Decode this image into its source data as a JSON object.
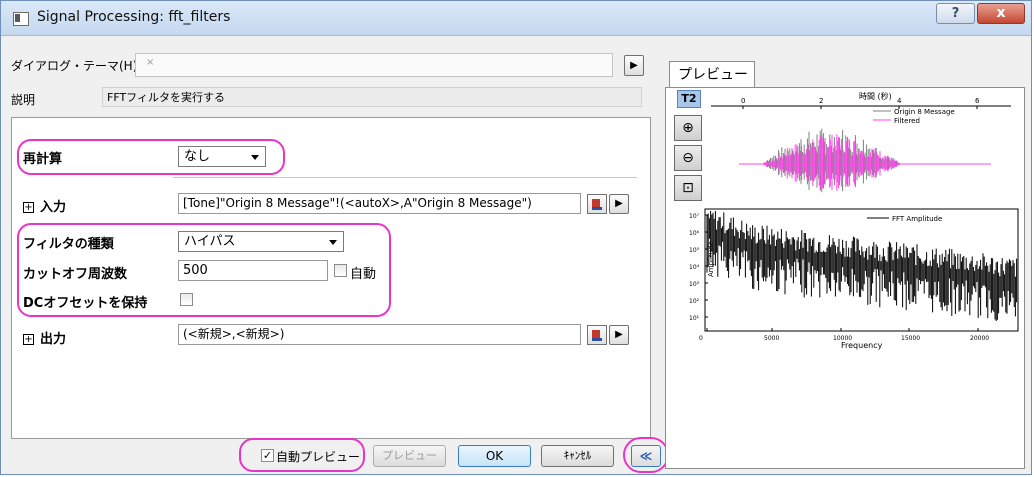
{
  "window": {
    "title": "Signal Processing: fft_filters"
  },
  "titlebar": {
    "help_label": "?",
    "close_label": "x"
  },
  "theme": {
    "label": "ダイアログ・テーマ(H)",
    "value": "",
    "clear_glyph": "×",
    "menu_arrow": "▶"
  },
  "description": {
    "label": "説明",
    "value": "FFTフィルタを実行する"
  },
  "recalc": {
    "label": "再計算",
    "value": "なし"
  },
  "input": {
    "label": "入力",
    "expander": "⊞",
    "value": "[Tone]\"Origin 8 Message\"!(<autoX>,A\"Origin 8 Message\")"
  },
  "filter_type": {
    "label": "フィルタの種類",
    "value": "ハイパス"
  },
  "cutoff": {
    "label": "カットオフ周波数",
    "value": "500",
    "auto_label": "自動",
    "auto_checked": false
  },
  "dc_offset": {
    "label": "DCオフセットを保持",
    "checked": false
  },
  "output": {
    "label": "出力",
    "expander": "⊞",
    "value": "(<新規>,<新規>)"
  },
  "buttons": {
    "auto_preview_label": "自動プレビュー",
    "auto_preview_checked": true,
    "preview_label": "プレビュー",
    "ok_label": "OK",
    "cancel_label": "ｷｬﾝｾﾙ",
    "collapse_label": "≪"
  },
  "preview": {
    "tab_label": "プレビュー",
    "t2_label": "T2",
    "tools": [
      "zoom-in-icon",
      "zoom-out-icon",
      "zoom-fit-icon"
    ],
    "top_plot": {
      "xlabel": "時間 (秒)",
      "x_ticks": [
        "0",
        "2",
        "4",
        "6"
      ],
      "legend": [
        {
          "name": "Origin 8 Message",
          "color": "#808080"
        },
        {
          "name": "Filtered",
          "color": "#ff44ee"
        }
      ]
    },
    "bottom_plot": {
      "xlabel": "Frequency",
      "ylabel": "Amplitude",
      "x_ticks": [
        "0",
        "5000",
        "10000",
        "15000",
        "20000"
      ],
      "y_ticks": [
        "10⁷",
        "10⁶",
        "10⁵",
        "10⁴",
        "10³",
        "10²",
        "10¹"
      ],
      "legend": [
        {
          "name": "FFT Amplitude",
          "color": "#000000"
        }
      ]
    }
  },
  "colors": {
    "highlight": "#e636c8",
    "accent": "#3b7bbf"
  }
}
